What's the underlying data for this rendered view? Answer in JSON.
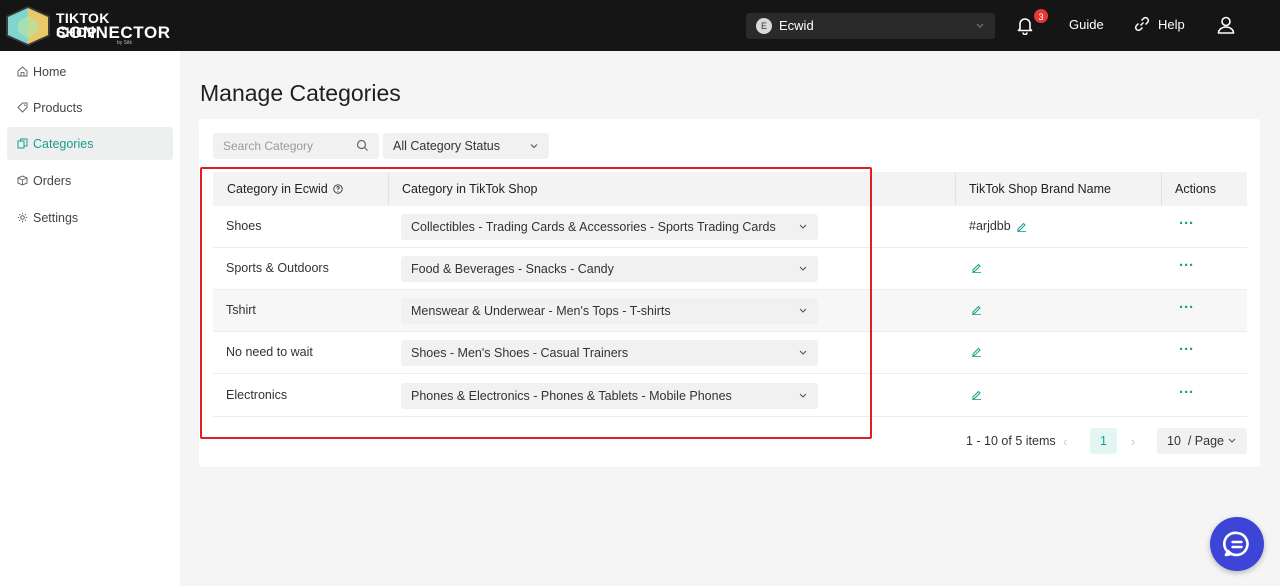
{
  "app": {
    "logo_line1": "TIKTOK SHOP",
    "logo_line2": "CONNECTOR",
    "logo_byline": "by Sitk"
  },
  "header": {
    "store_initial": "E",
    "store_name": "Ecwid",
    "notification_count": "3",
    "guide_label": "Guide",
    "help_label": "Help"
  },
  "sidebar": {
    "items": [
      {
        "label": "Home",
        "icon": "home-icon"
      },
      {
        "label": "Products",
        "icon": "tag-icon"
      },
      {
        "label": "Categories",
        "icon": "copy-icon",
        "active": true
      },
      {
        "label": "Orders",
        "icon": "box-icon"
      },
      {
        "label": "Settings",
        "icon": "gear-icon"
      }
    ]
  },
  "page": {
    "title": "Manage Categories"
  },
  "filters": {
    "search_placeholder": "Search Category",
    "status_value": "All Category Status"
  },
  "table": {
    "headers": {
      "ecwid": "Category in Ecwid",
      "tiktok": "Category in TikTok Shop",
      "brand": "TikTok Shop Brand Name",
      "actions": "Actions"
    },
    "rows": [
      {
        "ecwid": "Shoes",
        "tiktok": "Collectibles - Trading Cards & Accessories - Sports Trading Cards",
        "brand": "#arjdbb"
      },
      {
        "ecwid": "Sports & Outdoors",
        "tiktok": "Food & Beverages - Snacks - Candy",
        "brand": ""
      },
      {
        "ecwid": "Tshirt",
        "tiktok": "Menswear & Underwear - Men's Tops - T-shirts",
        "brand": ""
      },
      {
        "ecwid": "No need to wait",
        "tiktok": "Shoes - Men's Shoes - Casual Trainers",
        "brand": ""
      },
      {
        "ecwid": "Electronics",
        "tiktok": "Phones & Electronics - Phones & Tablets - Mobile Phones",
        "brand": ""
      }
    ],
    "more_glyph": "···"
  },
  "pagination": {
    "info": "1 - 10 of 5 items",
    "prev": "‹",
    "current_page": "1",
    "next": "›",
    "page_size": "10  / Page"
  },
  "colors": {
    "accent": "#1a9e8c",
    "topbar": "#151515",
    "highlight": "#e02020",
    "chat": "#3c45d6"
  }
}
